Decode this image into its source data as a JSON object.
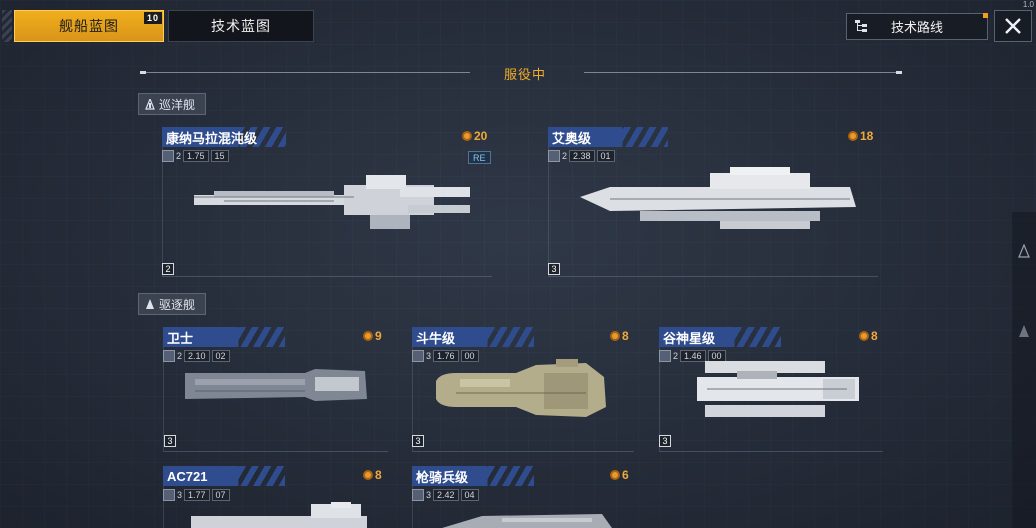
{
  "tabs": {
    "ship_blueprint": "舰船蓝图",
    "ship_blueprint_badge": "10",
    "tech_blueprint": "技术蓝图"
  },
  "top_right": {
    "tech_route": "技术路线",
    "corner_text": "1.0"
  },
  "section": {
    "title": "服役中"
  },
  "groups": {
    "cruiser": "巡洋舰",
    "destroyer": "驱逐舰"
  },
  "ships": {
    "kongnama": {
      "name": "康纳马拉混沌级",
      "level_small": "2",
      "stat": "1.75",
      "stat_sub": "15",
      "cost": "20",
      "tag": "RE",
      "tier": "2"
    },
    "aiao": {
      "name": "艾奥级",
      "level_small": "2",
      "stat": "2.38",
      "stat_sub": "01",
      "cost": "18",
      "tier": "3"
    },
    "weishi": {
      "name": "卫士",
      "level_small": "2",
      "stat": "2.10",
      "stat_sub": "02",
      "cost": "9",
      "tier": "3"
    },
    "douniu": {
      "name": "斗牛级",
      "level_small": "3",
      "stat": "1.76",
      "stat_sub": "00",
      "cost": "8",
      "tier": "3"
    },
    "gushen": {
      "name": "谷神星级",
      "level_small": "2",
      "stat": "1.46",
      "stat_sub": "00",
      "cost": "8",
      "tier": "3"
    },
    "ac721": {
      "name": "AC721",
      "level_small": "3",
      "stat": "1.77",
      "stat_sub": "07",
      "cost": "8"
    },
    "qiangqi": {
      "name": "枪骑兵级",
      "level_small": "3",
      "stat": "2.42",
      "stat_sub": "04",
      "cost": "6"
    }
  },
  "colors": {
    "accent": "#f0ae1c",
    "name_plate": "#2e4c8e",
    "cost": "#f0a93a",
    "background": "#29303d"
  }
}
